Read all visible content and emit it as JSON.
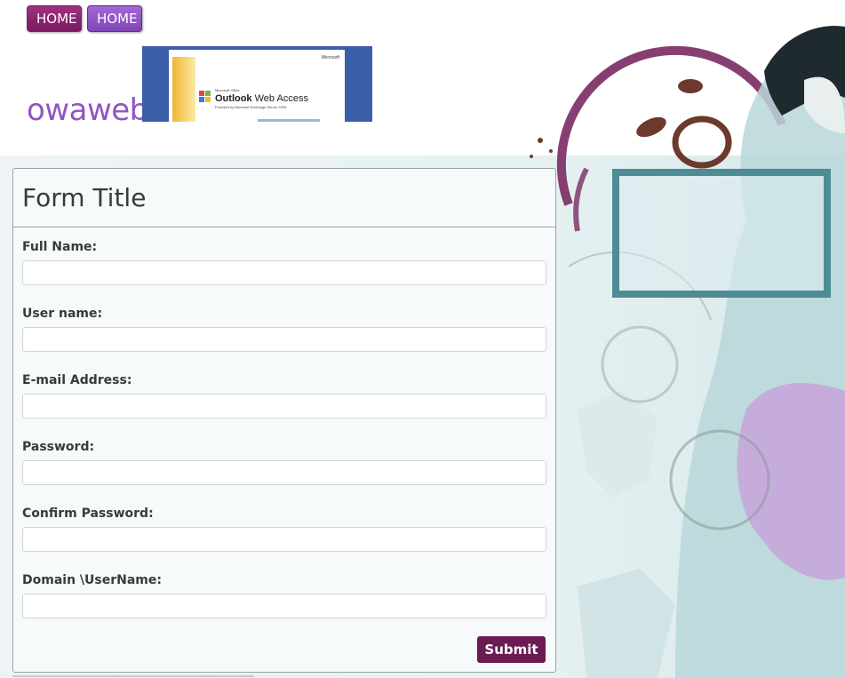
{
  "nav": {
    "home_1": "HOME",
    "home_2": "HOME"
  },
  "brand": "owaweb",
  "owa_banner": {
    "microsoft": "Microsoft",
    "small_line": "Microsoft Office",
    "title_bold": "Outlook",
    "title_rest": " Web Access",
    "sub_line": "Provided by Microsoft Exchange Server 2003"
  },
  "form": {
    "title": "Form Title",
    "fields": [
      {
        "label": "Full Name:",
        "value": "",
        "placeholder": ""
      },
      {
        "label": "User name:",
        "value": "",
        "placeholder": ""
      },
      {
        "label": "E-mail Address:",
        "value": "",
        "placeholder": ""
      },
      {
        "label": "Password:",
        "value": "",
        "placeholder": ""
      },
      {
        "label": "Confirm Password:",
        "value": "",
        "placeholder": ""
      },
      {
        "label": "Domain \\UserName:",
        "value": "",
        "placeholder": ""
      }
    ],
    "submit_label": "Submit"
  },
  "colors": {
    "nav_primary": "#8b2270",
    "nav_secondary": "#9055c2",
    "brand": "#9055c2",
    "submit": "#6b1b52",
    "side_box_border": "#4f8b94"
  }
}
